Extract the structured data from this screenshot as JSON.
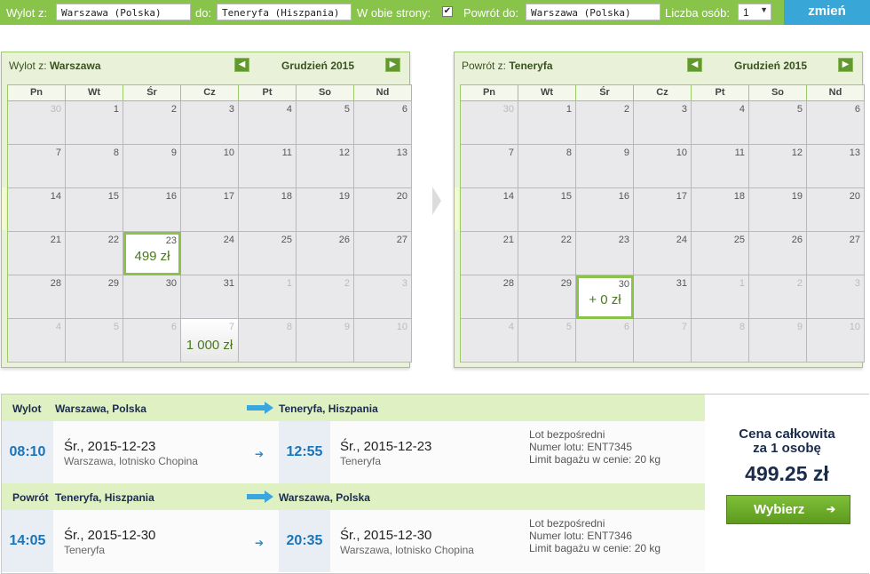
{
  "search": {
    "from_label": "Wylot z:",
    "from_value": "Warszawa (Polska)",
    "to_label": "do:",
    "to_value": "Teneryfa (Hiszpania)",
    "roundtrip_label": "W obie strony:",
    "roundtrip_checked": "✔",
    "return_label": "Powrót do:",
    "return_value": "Warszawa (Polska)",
    "persons_label": "Liczba osób:",
    "persons_value": "1",
    "submit_label": "zmień"
  },
  "weekdays": [
    "Pn",
    "Wt",
    "Śr",
    "Cz",
    "Pt",
    "So",
    "Nd"
  ],
  "calendars": [
    {
      "title_prefix": "Wylot z:",
      "city": "Warszawa",
      "month": "Grudzień 2015",
      "prev_icon": "arrow-left-icon",
      "next_icon": "arrow-right-icon",
      "weeks": [
        [
          {
            "d": "30",
            "other": true
          },
          {
            "d": "1"
          },
          {
            "d": "2"
          },
          {
            "d": "3"
          },
          {
            "d": "4"
          },
          {
            "d": "5"
          },
          {
            "d": "6"
          }
        ],
        [
          {
            "d": "7"
          },
          {
            "d": "8"
          },
          {
            "d": "9"
          },
          {
            "d": "10"
          },
          {
            "d": "11"
          },
          {
            "d": "12"
          },
          {
            "d": "13"
          }
        ],
        [
          {
            "d": "14"
          },
          {
            "d": "15"
          },
          {
            "d": "16"
          },
          {
            "d": "17"
          },
          {
            "d": "18"
          },
          {
            "d": "19"
          },
          {
            "d": "20"
          }
        ],
        [
          {
            "d": "21"
          },
          {
            "d": "22"
          },
          {
            "d": "23",
            "price": "499 zł",
            "selected": true
          },
          {
            "d": "24"
          },
          {
            "d": "25"
          },
          {
            "d": "26"
          },
          {
            "d": "27"
          }
        ],
        [
          {
            "d": "28"
          },
          {
            "d": "29"
          },
          {
            "d": "30"
          },
          {
            "d": "31"
          },
          {
            "d": "1",
            "other": true
          },
          {
            "d": "2",
            "other": true
          },
          {
            "d": "3",
            "other": true
          }
        ],
        [
          {
            "d": "4",
            "other": true
          },
          {
            "d": "5",
            "other": true
          },
          {
            "d": "6",
            "other": true
          },
          {
            "d": "7",
            "other": true,
            "price": "1 000 zł",
            "gradient": true
          },
          {
            "d": "8",
            "other": true
          },
          {
            "d": "9",
            "other": true
          },
          {
            "d": "10",
            "other": true
          }
        ]
      ]
    },
    {
      "title_prefix": "Powrót z:",
      "city": "Teneryfa",
      "month": "Grudzień 2015",
      "prev_icon": "arrow-left-icon",
      "next_icon": "arrow-right-icon",
      "weeks": [
        [
          {
            "d": "30",
            "other": true
          },
          {
            "d": "1"
          },
          {
            "d": "2"
          },
          {
            "d": "3"
          },
          {
            "d": "4"
          },
          {
            "d": "5"
          },
          {
            "d": "6"
          }
        ],
        [
          {
            "d": "7"
          },
          {
            "d": "8"
          },
          {
            "d": "9"
          },
          {
            "d": "10"
          },
          {
            "d": "11"
          },
          {
            "d": "12"
          },
          {
            "d": "13"
          }
        ],
        [
          {
            "d": "14"
          },
          {
            "d": "15"
          },
          {
            "d": "16"
          },
          {
            "d": "17"
          },
          {
            "d": "18"
          },
          {
            "d": "19"
          },
          {
            "d": "20"
          }
        ],
        [
          {
            "d": "21"
          },
          {
            "d": "22"
          },
          {
            "d": "23"
          },
          {
            "d": "24"
          },
          {
            "d": "25"
          },
          {
            "d": "26"
          },
          {
            "d": "27"
          }
        ],
        [
          {
            "d": "28"
          },
          {
            "d": "29"
          },
          {
            "d": "30",
            "price": "+ 0 zł",
            "selected": true
          },
          {
            "d": "31"
          },
          {
            "d": "1",
            "other": true
          },
          {
            "d": "2",
            "other": true
          },
          {
            "d": "3",
            "other": true
          }
        ],
        [
          {
            "d": "4",
            "other": true
          },
          {
            "d": "5",
            "other": true
          },
          {
            "d": "6",
            "other": true
          },
          {
            "d": "7",
            "other": true
          },
          {
            "d": "8",
            "other": true
          },
          {
            "d": "9",
            "other": true
          },
          {
            "d": "10",
            "other": true
          }
        ]
      ]
    }
  ],
  "flights": [
    {
      "label": "Wylot",
      "from": "Warszawa, Polska",
      "to": "Teneryfa, Hiszpania",
      "dep_time": "08:10",
      "dep_date": "Śr., 2015-12-23",
      "dep_place": "Warszawa, lotnisko Chopina",
      "arr_time": "12:55",
      "arr_date": "Śr., 2015-12-23",
      "arr_place": "Teneryfa",
      "info_direct": "Lot bezpośredni",
      "info_number": "Numer lotu: ENT7345",
      "info_baggage": "Limit bagażu w cenie: 20 kg"
    },
    {
      "label": "Powrót",
      "from": "Teneryfa, Hiszpania",
      "to": "Warszawa, Polska",
      "dep_time": "14:05",
      "dep_date": "Śr., 2015-12-30",
      "dep_place": "Teneryfa",
      "arr_time": "20:35",
      "arr_date": "Śr., 2015-12-30",
      "arr_place": "Warszawa, lotnisko Chopina",
      "info_direct": "Lot bezpośredni",
      "info_number": "Numer lotu: ENT7346",
      "info_baggage": "Limit bagażu w cenie: 20 kg"
    }
  ],
  "price": {
    "title_line1": "Cena całkowita",
    "title_line2": "za 1 osobę",
    "amount": "499.25 zł",
    "button_label": "Wybierz"
  },
  "colors": {
    "accent_green": "#88c44a",
    "button_blue": "#38a7d8",
    "time_blue": "#1a75b8",
    "navy": "#1a2b4c"
  }
}
